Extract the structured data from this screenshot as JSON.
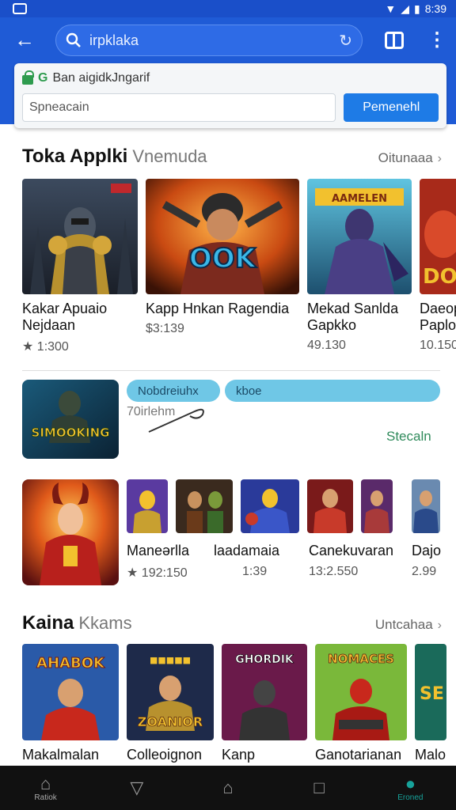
{
  "status_bar": {
    "time": "8:39"
  },
  "browser": {
    "query": "irpklaka",
    "site_label": "Ban aigidkJngarif",
    "field_placeholder": "Spneacain",
    "go_button": "Pemenehl"
  },
  "section1": {
    "title": "Toka Applki",
    "subtitle": "Vnemuda",
    "more": "Oitunaaa",
    "cards": [
      {
        "title": "Kakar Apuaio Nejdaan",
        "price": "★ 1:300",
        "poster": ""
      },
      {
        "title": "Kapp Hnkan Ragendia",
        "price": "$3:139",
        "poster": "OOK"
      },
      {
        "title": "Mekad Sanlda Gapkko",
        "price": "49.130",
        "poster": "AAMELEN"
      },
      {
        "title": "Daeop Paplo",
        "price": "10.150",
        "poster": "DO"
      }
    ]
  },
  "promo": {
    "chip1": "Nobdreiuhx",
    "chip2": "kboe",
    "note": "70irlehm",
    "link": "Stecaln",
    "poster": "SIMOOKING"
  },
  "section2": {
    "cards": [
      {
        "title": "Maneərlla",
        "price": "★ 192:150"
      },
      {
        "title": "laadamaia",
        "price": "1:39"
      },
      {
        "title": "Canekuvaran",
        "price": "13:2.550"
      },
      {
        "title": "Dajo",
        "price": "2.99"
      }
    ]
  },
  "section3": {
    "title": "Kaina",
    "subtitle": "Kkams",
    "more": "Untcahaa",
    "cards": [
      {
        "title": "Makalmalan",
        "poster": "AHABOK"
      },
      {
        "title": "Colleoignon",
        "poster": "ZOANIOR"
      },
      {
        "title": "Kanp",
        "poster": "GHORDIK"
      },
      {
        "title": "Ganotarianan",
        "poster": "NOMACES"
      },
      {
        "title": "Malo",
        "poster": "SE"
      }
    ]
  },
  "bottom_nav": {
    "items": [
      {
        "label": "Ratiok",
        "icon": "home-icon"
      },
      {
        "label": "",
        "icon": "triangle-icon"
      },
      {
        "label": "",
        "icon": "house-icon"
      },
      {
        "label": "",
        "icon": "square-icon"
      },
      {
        "label": "Eroned",
        "icon": "person-icon"
      }
    ]
  },
  "colors": {
    "appbar": "#1f5bd6",
    "statusbar": "#1a4fc9",
    "accent_button": "#1e7be6",
    "chip": "#6fc7e6",
    "link": "#2f8a5b",
    "nav_active": "#17a39b"
  }
}
